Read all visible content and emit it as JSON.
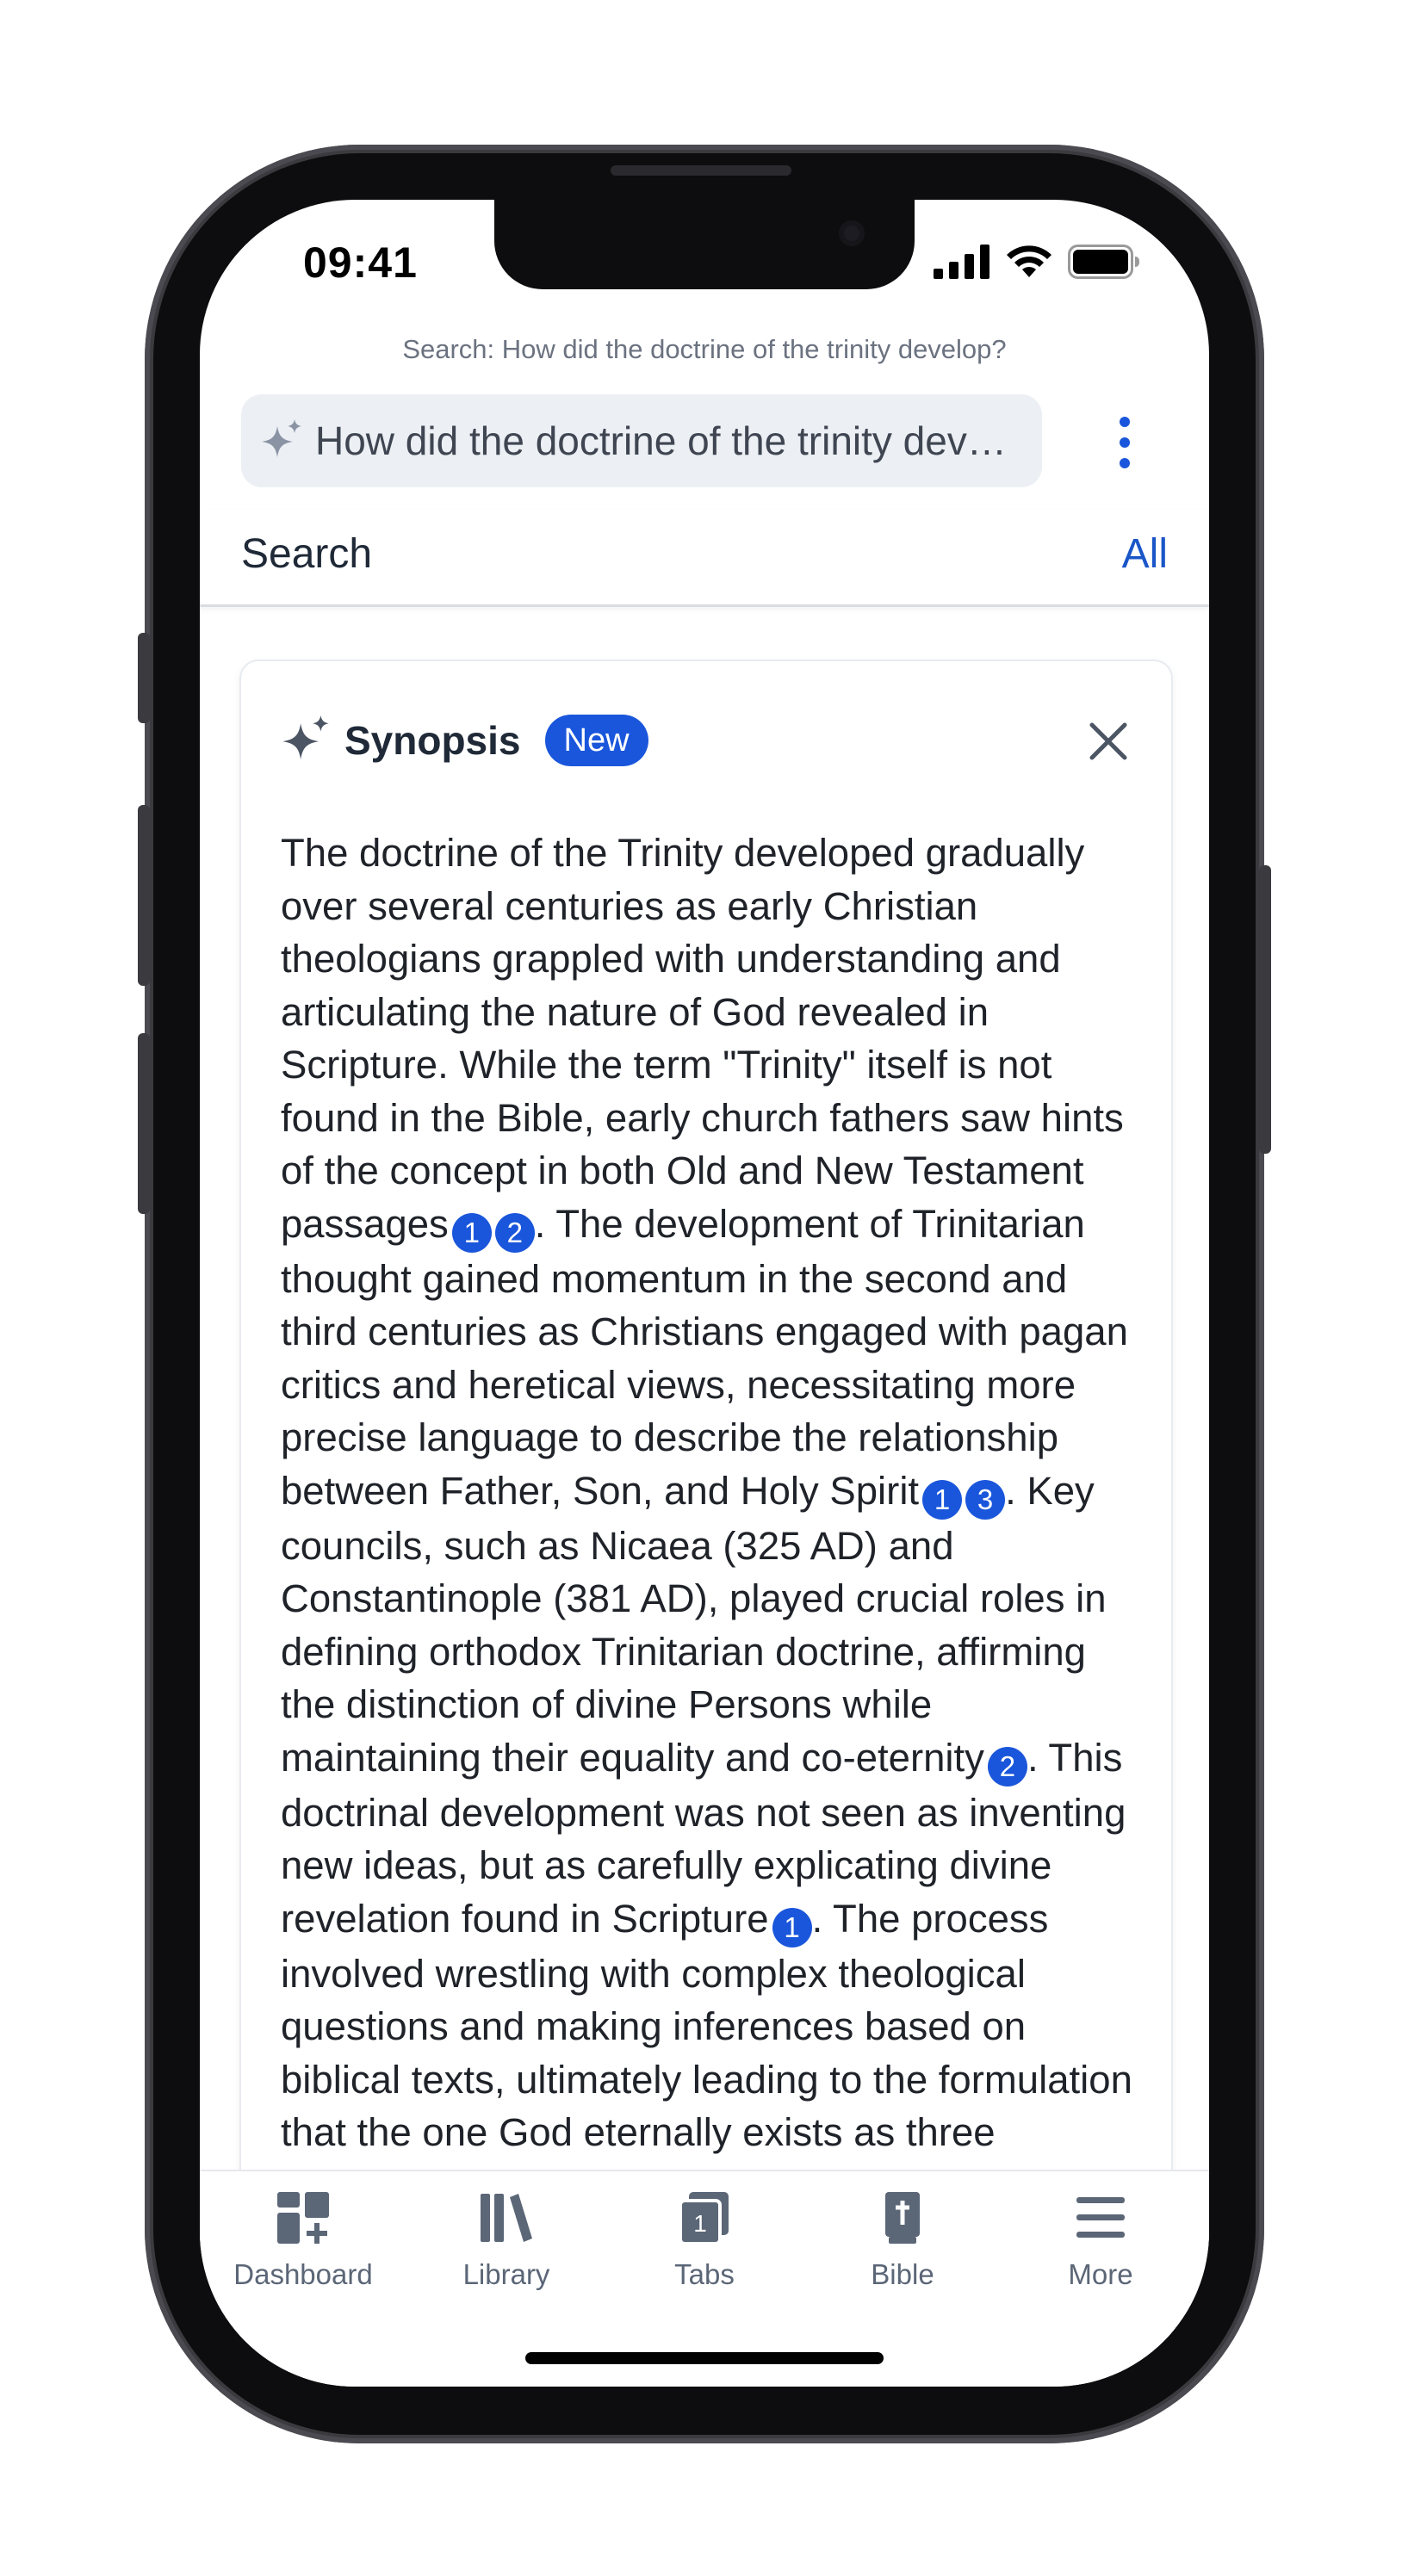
{
  "status_bar": {
    "time": "09:41"
  },
  "search": {
    "caption": "Search: How did the doctrine of the trinity develop?",
    "query": "How did the doctrine of the trinity develop?"
  },
  "tab_row": {
    "title": "Search",
    "filter_label": "All"
  },
  "synopsis": {
    "title": "Synopsis",
    "badge": "New",
    "segments": [
      {
        "text": "The doctrine of the Trinity developed gradually over several centuries as early Christian theologians grappled with understanding and articulating the nature of God revealed in Scripture. While the term \"Trinity\" itself is not found in the Bible, early church fathers saw hints of the concept in both Old and New Testament passages",
        "cites": [
          "1",
          "2"
        ]
      },
      {
        "text": ". The development of Trinitarian thought gained momentum in the second and third centuries as Christians engaged with pagan critics and heretical views, necessitating more precise language to describe the relationship between Father, Son, and Holy Spirit",
        "cites": [
          "1",
          "3"
        ]
      },
      {
        "text": ". Key councils, such as Nicaea (325 AD) and Constantinople (381 AD), played crucial roles in defining orthodox Trinitarian doctrine, affirming the distinction of divine Persons while maintaining their equality and co-eternity",
        "cites": [
          "2"
        ]
      },
      {
        "text": ". This doctrinal development was not seen as inventing new ideas, but as carefully explicating divine revelation found in Scripture",
        "cites": [
          "1"
        ]
      },
      {
        "text": ". The process involved wrestling with complex theological questions and making inferences based on biblical texts, ultimately leading to the formulation that the one God eternally exists as three Persons:",
        "cites": []
      }
    ]
  },
  "bottom_nav": [
    {
      "label": "Dashboard",
      "icon": "dashboard-icon"
    },
    {
      "label": "Library",
      "icon": "library-icon"
    },
    {
      "label": "Tabs",
      "icon": "tabs-icon",
      "count": "1"
    },
    {
      "label": "Bible",
      "icon": "bible-icon"
    },
    {
      "label": "More",
      "icon": "menu-icon"
    }
  ],
  "colors": {
    "accent": "#1a56db",
    "link": "#1a56c8",
    "text": "#1f2329",
    "nav_icon": "#5b6677"
  }
}
